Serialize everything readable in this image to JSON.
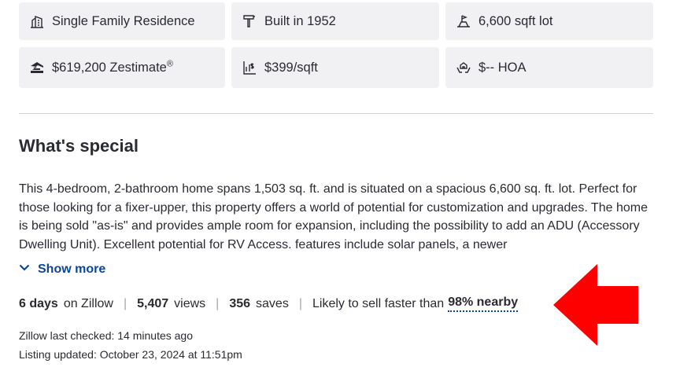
{
  "facts": [
    {
      "icon": "house-building-icon",
      "label": "Single Family Residence"
    },
    {
      "icon": "hammer-icon",
      "label": "Built in 1952"
    },
    {
      "icon": "lot-size-icon",
      "label": "6,600 sqft lot"
    },
    {
      "icon": "zillow-z-icon",
      "label": "$619,200 Zestimate",
      "sup": "®"
    },
    {
      "icon": "price-per-sqft-icon",
      "label": "$399/sqft"
    },
    {
      "icon": "hoa-hands-icon",
      "label": "$-- HOA"
    }
  ],
  "section": {
    "title": "What's special"
  },
  "description": "This 4-bedroom, 2-bathroom home spans 1,503 sq. ft. and is situated on a spacious 6,600 sq. ft. lot. Perfect for those looking for a fixer-upper, this property offers a world of potential for customization and upgrades. The home is being sold \"as-is\" and provides ample room for expansion, including the possibility to add an ADU (Accessory Dwelling Unit).  Excellent potential for RV Access.      features include solar panels, a newer",
  "show_more_label": "Show more",
  "stats": {
    "days_value": "6 days",
    "days_label": "on Zillow",
    "views_value": "5,407",
    "views_label": "views",
    "saves_value": "356",
    "saves_label": "saves",
    "sell_text": "Likely to sell faster than",
    "sell_highlight": "98% nearby",
    "separator": "|"
  },
  "meta": {
    "last_checked": "Zillow last checked: 14 minutes ago",
    "listing_updated": "Listing updated: October 23, 2024 at 11:51pm"
  },
  "colors": {
    "accent_link": "#0d4599",
    "fact_bg": "#f1f1f4",
    "annotation_arrow": "#ff0000"
  }
}
